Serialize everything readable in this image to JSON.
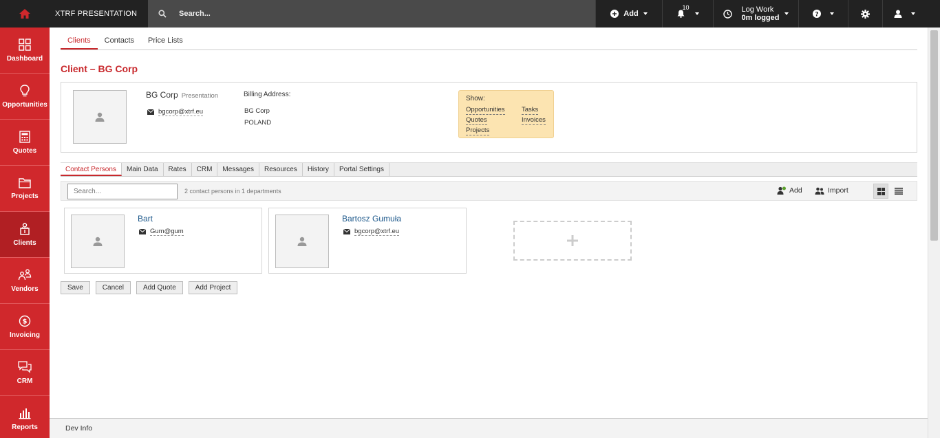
{
  "topbar": {
    "brand": "XTRF PRESENTATION",
    "search_placeholder": "Search...",
    "add_label": "Add",
    "notifications_count": "10",
    "log_work_line1": "Log Work",
    "log_work_line2": "0m logged"
  },
  "sidebar": {
    "items": [
      {
        "label": "Dashboard",
        "icon": "dashboard-icon"
      },
      {
        "label": "Opportunities",
        "icon": "lightbulb-icon"
      },
      {
        "label": "Quotes",
        "icon": "calculator-icon"
      },
      {
        "label": "Projects",
        "icon": "folder-icon"
      },
      {
        "label": "Clients",
        "icon": "client-icon"
      },
      {
        "label": "Vendors",
        "icon": "vendors-icon"
      },
      {
        "label": "Invoicing",
        "icon": "dollar-icon"
      },
      {
        "label": "CRM",
        "icon": "chat-icon"
      },
      {
        "label": "Reports",
        "icon": "bar-chart-icon"
      }
    ]
  },
  "subtabs": [
    "Clients",
    "Contacts",
    "Price Lists"
  ],
  "page_title": "Client – BG Corp",
  "client": {
    "name": "BG Corp",
    "tag": "Presentation",
    "email": "bgcorp@xtrf.eu",
    "billing_label": "Billing Address:",
    "billing_line1": "BG Corp",
    "billing_line2": "POLAND"
  },
  "show_box": {
    "label": "Show:",
    "links": [
      "Opportunities",
      "Tasks",
      "Quotes",
      "Invoices",
      "Projects"
    ]
  },
  "content_tabs": [
    "Contact Persons",
    "Main Data",
    "Rates",
    "CRM",
    "Messages",
    "Resources",
    "History",
    "Portal Settings"
  ],
  "toolbar": {
    "search_placeholder": "Search...",
    "count_text": "2 contact persons in 1 departments",
    "add_label": "Add",
    "import_label": "Import"
  },
  "persons": [
    {
      "name": "Bart",
      "email": "Gum@gum"
    },
    {
      "name": "Bartosz Gumuła",
      "email": "bgcorp@xtrf.eu"
    }
  ],
  "buttons": {
    "save": "Save",
    "cancel": "Cancel",
    "add_quote": "Add Quote",
    "add_project": "Add Project"
  },
  "footer": {
    "dev_info": "Dev Info"
  },
  "colors": {
    "brand_red": "#d0282c",
    "topbar_bg": "#222222",
    "show_box_bg": "#fce4b1",
    "link_blue": "#1f5a8c"
  }
}
